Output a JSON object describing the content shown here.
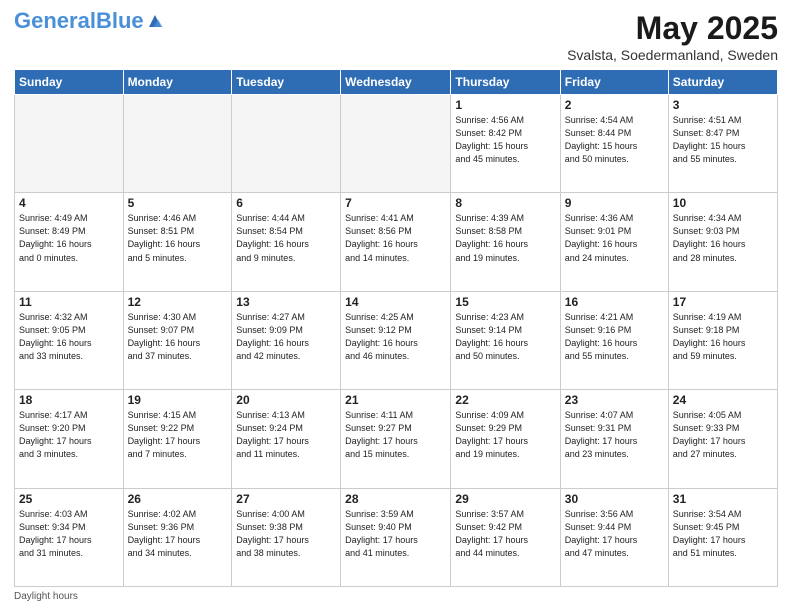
{
  "header": {
    "logo_general": "General",
    "logo_blue": "Blue",
    "title": "May 2025",
    "subtitle": "Svalsta, Soedermanland, Sweden"
  },
  "days_of_week": [
    "Sunday",
    "Monday",
    "Tuesday",
    "Wednesday",
    "Thursday",
    "Friday",
    "Saturday"
  ],
  "weeks": [
    [
      {
        "day": "",
        "info": ""
      },
      {
        "day": "",
        "info": ""
      },
      {
        "day": "",
        "info": ""
      },
      {
        "day": "",
        "info": ""
      },
      {
        "day": "1",
        "info": "Sunrise: 4:56 AM\nSunset: 8:42 PM\nDaylight: 15 hours\nand 45 minutes."
      },
      {
        "day": "2",
        "info": "Sunrise: 4:54 AM\nSunset: 8:44 PM\nDaylight: 15 hours\nand 50 minutes."
      },
      {
        "day": "3",
        "info": "Sunrise: 4:51 AM\nSunset: 8:47 PM\nDaylight: 15 hours\nand 55 minutes."
      }
    ],
    [
      {
        "day": "4",
        "info": "Sunrise: 4:49 AM\nSunset: 8:49 PM\nDaylight: 16 hours\nand 0 minutes."
      },
      {
        "day": "5",
        "info": "Sunrise: 4:46 AM\nSunset: 8:51 PM\nDaylight: 16 hours\nand 5 minutes."
      },
      {
        "day": "6",
        "info": "Sunrise: 4:44 AM\nSunset: 8:54 PM\nDaylight: 16 hours\nand 9 minutes."
      },
      {
        "day": "7",
        "info": "Sunrise: 4:41 AM\nSunset: 8:56 PM\nDaylight: 16 hours\nand 14 minutes."
      },
      {
        "day": "8",
        "info": "Sunrise: 4:39 AM\nSunset: 8:58 PM\nDaylight: 16 hours\nand 19 minutes."
      },
      {
        "day": "9",
        "info": "Sunrise: 4:36 AM\nSunset: 9:01 PM\nDaylight: 16 hours\nand 24 minutes."
      },
      {
        "day": "10",
        "info": "Sunrise: 4:34 AM\nSunset: 9:03 PM\nDaylight: 16 hours\nand 28 minutes."
      }
    ],
    [
      {
        "day": "11",
        "info": "Sunrise: 4:32 AM\nSunset: 9:05 PM\nDaylight: 16 hours\nand 33 minutes."
      },
      {
        "day": "12",
        "info": "Sunrise: 4:30 AM\nSunset: 9:07 PM\nDaylight: 16 hours\nand 37 minutes."
      },
      {
        "day": "13",
        "info": "Sunrise: 4:27 AM\nSunset: 9:09 PM\nDaylight: 16 hours\nand 42 minutes."
      },
      {
        "day": "14",
        "info": "Sunrise: 4:25 AM\nSunset: 9:12 PM\nDaylight: 16 hours\nand 46 minutes."
      },
      {
        "day": "15",
        "info": "Sunrise: 4:23 AM\nSunset: 9:14 PM\nDaylight: 16 hours\nand 50 minutes."
      },
      {
        "day": "16",
        "info": "Sunrise: 4:21 AM\nSunset: 9:16 PM\nDaylight: 16 hours\nand 55 minutes."
      },
      {
        "day": "17",
        "info": "Sunrise: 4:19 AM\nSunset: 9:18 PM\nDaylight: 16 hours\nand 59 minutes."
      }
    ],
    [
      {
        "day": "18",
        "info": "Sunrise: 4:17 AM\nSunset: 9:20 PM\nDaylight: 17 hours\nand 3 minutes."
      },
      {
        "day": "19",
        "info": "Sunrise: 4:15 AM\nSunset: 9:22 PM\nDaylight: 17 hours\nand 7 minutes."
      },
      {
        "day": "20",
        "info": "Sunrise: 4:13 AM\nSunset: 9:24 PM\nDaylight: 17 hours\nand 11 minutes."
      },
      {
        "day": "21",
        "info": "Sunrise: 4:11 AM\nSunset: 9:27 PM\nDaylight: 17 hours\nand 15 minutes."
      },
      {
        "day": "22",
        "info": "Sunrise: 4:09 AM\nSunset: 9:29 PM\nDaylight: 17 hours\nand 19 minutes."
      },
      {
        "day": "23",
        "info": "Sunrise: 4:07 AM\nSunset: 9:31 PM\nDaylight: 17 hours\nand 23 minutes."
      },
      {
        "day": "24",
        "info": "Sunrise: 4:05 AM\nSunset: 9:33 PM\nDaylight: 17 hours\nand 27 minutes."
      }
    ],
    [
      {
        "day": "25",
        "info": "Sunrise: 4:03 AM\nSunset: 9:34 PM\nDaylight: 17 hours\nand 31 minutes."
      },
      {
        "day": "26",
        "info": "Sunrise: 4:02 AM\nSunset: 9:36 PM\nDaylight: 17 hours\nand 34 minutes."
      },
      {
        "day": "27",
        "info": "Sunrise: 4:00 AM\nSunset: 9:38 PM\nDaylight: 17 hours\nand 38 minutes."
      },
      {
        "day": "28",
        "info": "Sunrise: 3:59 AM\nSunset: 9:40 PM\nDaylight: 17 hours\nand 41 minutes."
      },
      {
        "day": "29",
        "info": "Sunrise: 3:57 AM\nSunset: 9:42 PM\nDaylight: 17 hours\nand 44 minutes."
      },
      {
        "day": "30",
        "info": "Sunrise: 3:56 AM\nSunset: 9:44 PM\nDaylight: 17 hours\nand 47 minutes."
      },
      {
        "day": "31",
        "info": "Sunrise: 3:54 AM\nSunset: 9:45 PM\nDaylight: 17 hours\nand 51 minutes."
      }
    ]
  ],
  "footer": {
    "daylight_label": "Daylight hours"
  }
}
